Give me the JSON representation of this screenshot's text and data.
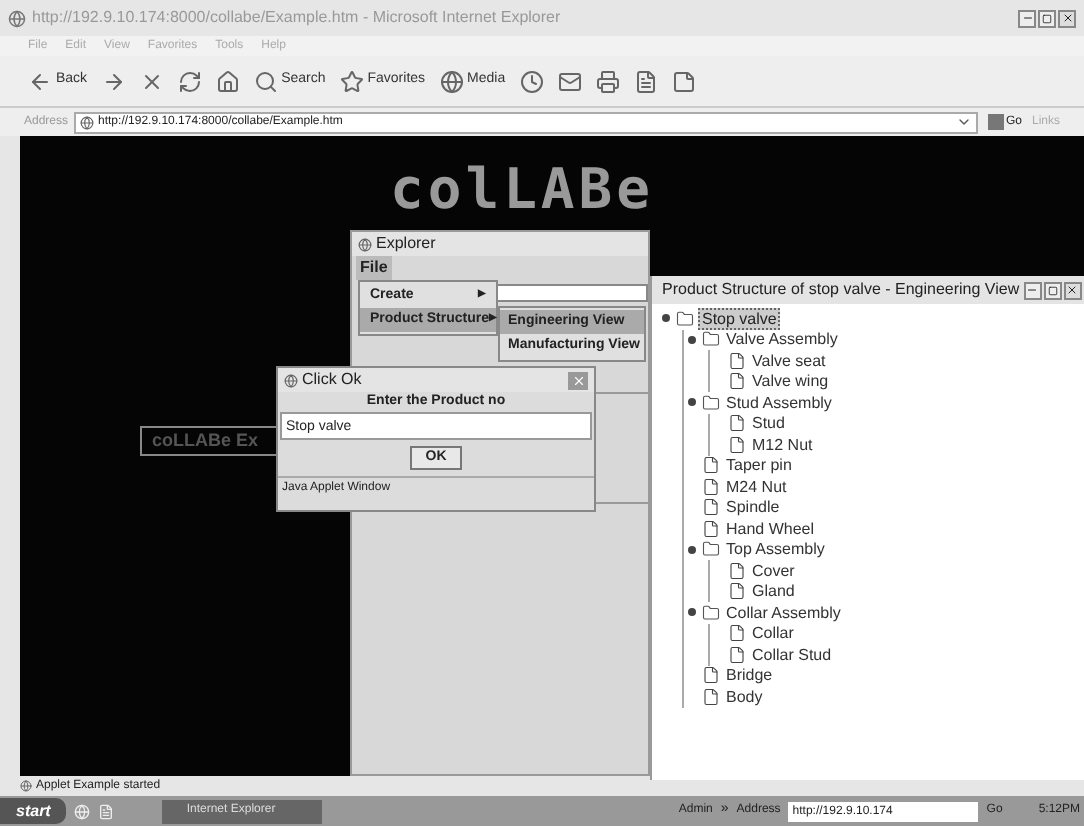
{
  "browser": {
    "title": "http://192.9.10.174:8000/collabe/Example.htm - Microsoft Internet Explorer",
    "menu": [
      "File",
      "Edit",
      "View",
      "Favorites",
      "Tools",
      "Help"
    ],
    "toolbar": [
      {
        "kind": "back",
        "label": "Back"
      },
      {
        "kind": "forward"
      },
      {
        "kind": "stop"
      },
      {
        "kind": "refresh"
      },
      {
        "kind": "home"
      },
      {
        "kind": "search",
        "label": "Search"
      },
      {
        "kind": "favorites",
        "label": "Favorites"
      },
      {
        "kind": "media",
        "label": "Media"
      },
      {
        "kind": "history"
      },
      {
        "kind": "mail"
      },
      {
        "kind": "print"
      },
      {
        "kind": "edit"
      },
      {
        "kind": "note"
      }
    ],
    "address": {
      "label": "Address",
      "value": "http://192.9.10.174:8000/collabe/Example.htm",
      "go": "Go",
      "links": "Links"
    }
  },
  "applet": {
    "logo": "colLABe",
    "caption": "coLLABe Ex"
  },
  "explorer": {
    "title": "Explorer",
    "menu": "File",
    "items": [
      {
        "label": "Create",
        "arrow": "▶",
        "selected": false
      },
      {
        "label": "Product Structure",
        "arrow": "▶",
        "selected": true
      }
    ],
    "submenu": [
      {
        "label": "Engineering View",
        "selected": true
      },
      {
        "label": "Manufacturing View",
        "selected": false
      }
    ]
  },
  "dialog": {
    "title": "Click Ok",
    "prompt": "Enter the Product no",
    "value": "Stop valve",
    "button": "OK",
    "footer": "Java Applet Window"
  },
  "tree_window": {
    "title": "Product Structure of stop valve - Engineering View",
    "root": {
      "label": "Stop valve",
      "kind": "folder",
      "expanded": true,
      "selected": true,
      "children": [
        {
          "label": "Valve Assembly",
          "kind": "folder",
          "expanded": true,
          "selected": false,
          "children": [
            {
              "label": "Valve seat",
              "kind": "file",
              "selected": false
            },
            {
              "label": "Valve wing",
              "kind": "file",
              "selected": false
            }
          ]
        },
        {
          "label": "Stud Assembly",
          "kind": "folder",
          "expanded": true,
          "selected": false,
          "children": [
            {
              "label": "Stud",
              "kind": "file",
              "selected": false
            },
            {
              "label": "M12 Nut",
              "kind": "file",
              "selected": false
            }
          ]
        },
        {
          "label": "Taper pin",
          "kind": "file",
          "selected": false
        },
        {
          "label": "M24 Nut",
          "kind": "file",
          "selected": false
        },
        {
          "label": "Spindle",
          "kind": "file",
          "selected": false
        },
        {
          "label": "Hand Wheel",
          "kind": "file",
          "selected": false
        },
        {
          "label": "Top Assembly",
          "kind": "folder",
          "expanded": true,
          "selected": false,
          "children": [
            {
              "label": "Cover",
              "kind": "file",
              "selected": false
            },
            {
              "label": "Gland",
              "kind": "file",
              "selected": false
            }
          ]
        },
        {
          "label": "Collar Assembly",
          "kind": "folder",
          "expanded": true,
          "selected": false,
          "children": [
            {
              "label": "Collar",
              "kind": "file",
              "selected": false
            },
            {
              "label": "Collar Stud",
              "kind": "file",
              "selected": false
            }
          ]
        },
        {
          "label": "Bridge",
          "kind": "file",
          "selected": false
        },
        {
          "label": "Body",
          "kind": "file",
          "selected": false
        }
      ]
    }
  },
  "status_bar": "Applet Example started",
  "taskbar": {
    "start": "start",
    "task": "Internet Explorer",
    "user": "Admin",
    "chevron": "»",
    "address_label": "Address",
    "address": "http://192.9.10.174",
    "go": "Go",
    "clock": "5:12PM"
  }
}
